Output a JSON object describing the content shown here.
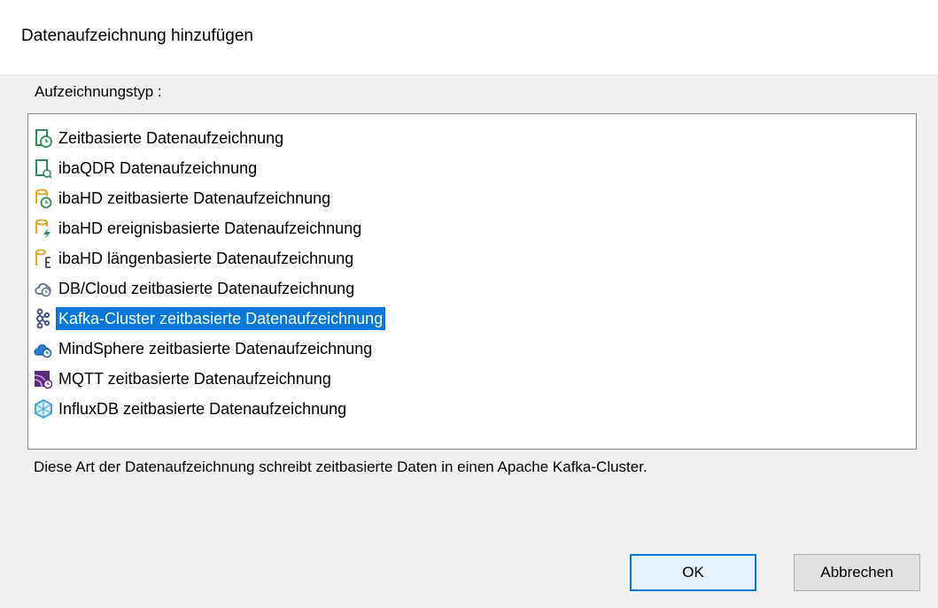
{
  "dialog": {
    "title": "Datenaufzeichnung hinzufügen",
    "type_label": "Aufzeichnungstyp :",
    "description": "Diese Art der Datenaufzeichnung schreibt zeitbasierte Daten in einen Apache Kafka-Cluster.",
    "ok_label": "OK",
    "cancel_label": "Abbrechen"
  },
  "list": {
    "items": [
      {
        "label": "Zeitbasierte Datenaufzeichnung",
        "icon": "time-recording-icon",
        "selected": false
      },
      {
        "label": "ibaQDR Datenaufzeichnung",
        "icon": "qdr-recording-icon",
        "selected": false
      },
      {
        "label": "ibaHD zeitbasierte Datenaufzeichnung",
        "icon": "hd-time-icon",
        "selected": false
      },
      {
        "label": "ibaHD ereignisbasierte Datenaufzeichnung",
        "icon": "hd-event-icon",
        "selected": false
      },
      {
        "label": "ibaHD längenbasierte Datenaufzeichnung",
        "icon": "hd-length-icon",
        "selected": false
      },
      {
        "label": "DB/Cloud zeitbasierte Datenaufzeichnung",
        "icon": "db-cloud-icon",
        "selected": false
      },
      {
        "label": "Kafka-Cluster zeitbasierte Datenaufzeichnung",
        "icon": "kafka-icon",
        "selected": true
      },
      {
        "label": "MindSphere zeitbasierte Datenaufzeichnung",
        "icon": "mindsphere-icon",
        "selected": false
      },
      {
        "label": "MQTT zeitbasierte Datenaufzeichnung",
        "icon": "mqtt-icon",
        "selected": false
      },
      {
        "label": "InfluxDB zeitbasierte Datenaufzeichnung",
        "icon": "influxdb-icon",
        "selected": false
      }
    ]
  },
  "colors": {
    "selection": "#0078d7",
    "window_bg": "#f0f0f0",
    "default_button_border": "#0078d7"
  }
}
